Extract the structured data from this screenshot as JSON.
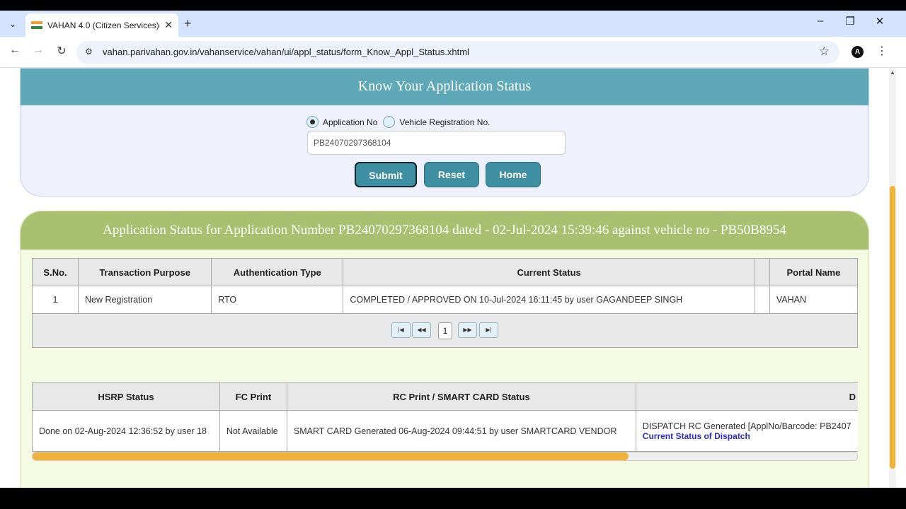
{
  "browser": {
    "tab_title": "VAHAN 4.0 (Citizen Services)--o",
    "url": "vahan.parivahan.gov.in/vahanservice/vahan/ui/appl_status/form_Know_Appl_Status.xhtml",
    "new_tab": "+",
    "minimize": "–",
    "restore": "❐",
    "close": "✕"
  },
  "search_panel": {
    "title": "Know Your Application Status",
    "radio_app": "Application No",
    "radio_vehicle": "Vehicle Registration No.",
    "app_number": "PB24070297368104",
    "submit": "Submit",
    "reset": "Reset",
    "home": "Home"
  },
  "status_panel": {
    "title": "Application Status for Application Number PB24070297368104 dated - 02-Jul-2024 15:39:46 against vehicle no - PB50B8954",
    "table1": {
      "headers": [
        "S.No.",
        "Transaction Purpose",
        "Authentication Type",
        "Current Status",
        "",
        "Portal Name"
      ],
      "row": [
        "1",
        "New Registration",
        "RTO",
        "COMPLETED / APPROVED ON 10-Jul-2024 16:11:45 by user GAGANDEEP SINGH",
        "",
        "VAHAN"
      ]
    },
    "pager": {
      "page": "1"
    },
    "table2": {
      "headers": [
        "HSRP Status",
        "FC Print",
        "RC Print / SMART CARD Status",
        "D"
      ],
      "row": [
        "Done on 02-Aug-2024 12:36:52 by user 18",
        "Not Available",
        "SMART CARD Generated 06-Aug-2024 09:44:51 by user SMARTCARD VENDOR",
        "DISPATCH RC Generated [ApplNo/Barcode: PB2407"
      ],
      "dispatch_link": "Current Status of Dispatch"
    }
  },
  "colors": {
    "search_header": "#5fa8b8",
    "status_header": "#a8c070",
    "button": "#3f8fa3",
    "scroll_accent": "#f2b23a"
  }
}
